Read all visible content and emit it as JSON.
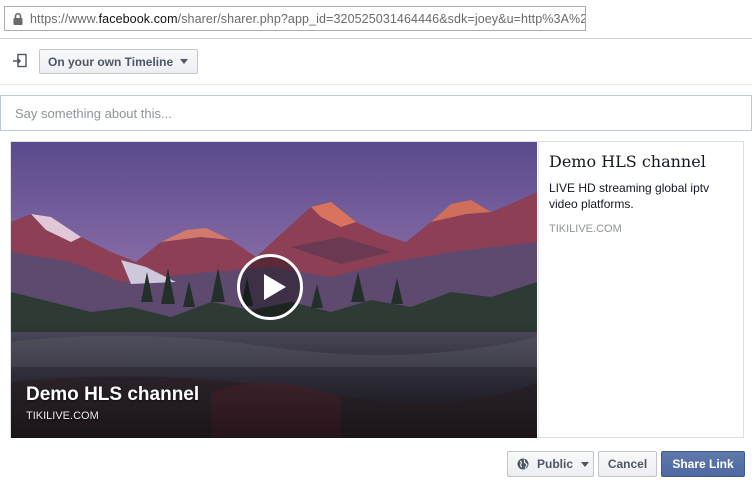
{
  "browser": {
    "url_prefix": "https://www.",
    "url_domain": "facebook.com",
    "url_rest": "/sharer/sharer.php?app_id=320525031464446&sdk=joey&u=http%3A%2F%2F"
  },
  "audience": {
    "selector_label": "On your own Timeline"
  },
  "composer": {
    "placeholder": "Say something about this..."
  },
  "preview": {
    "overlay_title": "Demo HLS channel",
    "overlay_domain": "TIKILIVE.COM",
    "title": "Demo HLS channel",
    "description": "LIVE HD streaming global iptv video platforms.",
    "domain": "TIKILIVE.COM"
  },
  "footer": {
    "privacy_label": "Public",
    "cancel_label": "Cancel",
    "share_label": "Share Link"
  },
  "colors": {
    "accent": "#4e69a2",
    "button_text": "#4e5665",
    "muted_text": "#90949c"
  }
}
